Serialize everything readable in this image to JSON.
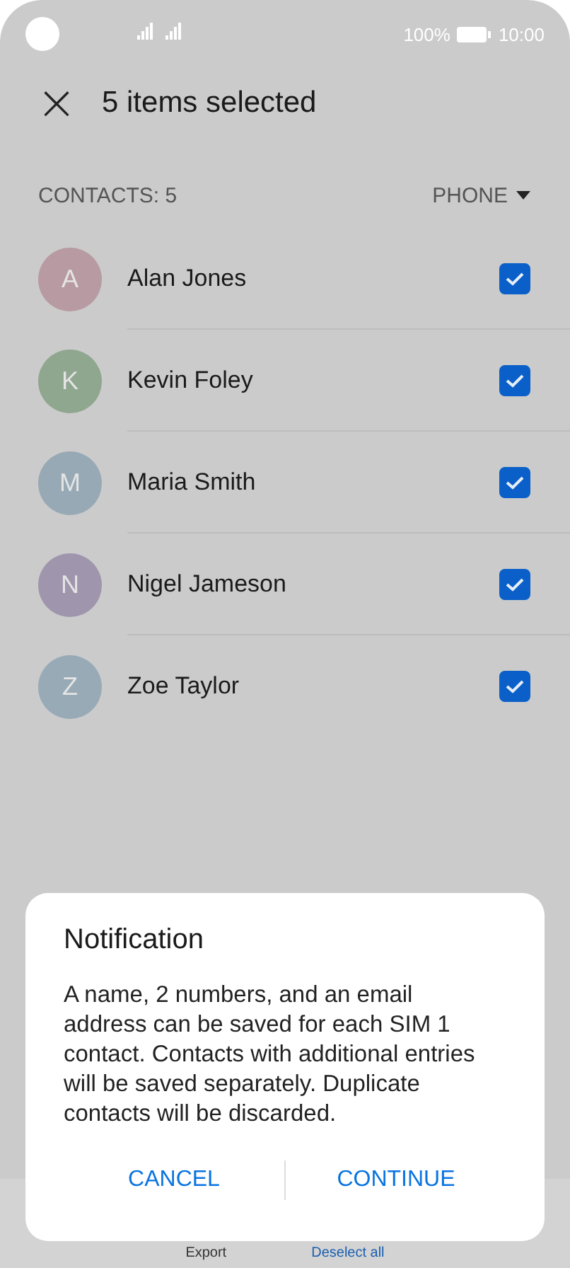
{
  "status_bar": {
    "battery": "100%",
    "time": "10:00"
  },
  "header": {
    "close": "×",
    "title": "5 items selected"
  },
  "list_header": {
    "count": "CONTACTS: 5",
    "filter": "PHONE"
  },
  "contacts": [
    {
      "initial": "A",
      "name": "Alan Jones",
      "color": "#b89aa2",
      "checked": true
    },
    {
      "initial": "K",
      "name": "Kevin Foley",
      "color": "#8fa68f",
      "checked": true
    },
    {
      "initial": "M",
      "name": "Maria Smith",
      "color": "#97a9b5",
      "checked": true
    },
    {
      "initial": "N",
      "name": "Nigel Jameson",
      "color": "#9f95ac",
      "checked": true
    },
    {
      "initial": "Z",
      "name": "Zoe Taylor",
      "color": "#97aab6",
      "checked": true
    }
  ],
  "bottom_bar": [
    "Export",
    "Deselect all"
  ],
  "dialog": {
    "title": "Notification",
    "message": "A name, 2 numbers, and an email address can be saved for each SIM 1 contact. Contacts with additional entries will be saved separately. Duplicate contacts will be discarded.",
    "buttons": [
      "CANCEL",
      "CONTINUE"
    ]
  }
}
